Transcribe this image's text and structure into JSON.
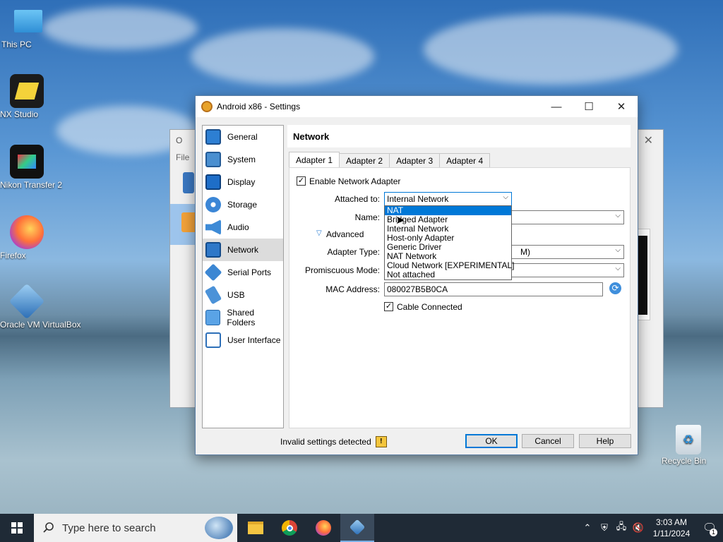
{
  "desktop": {
    "icons": [
      {
        "label": "This PC"
      },
      {
        "label": "NX Studio"
      },
      {
        "label": "Nikon Transfer 2"
      },
      {
        "label": "Firefox"
      },
      {
        "label": "Oracle VM VirtualBox"
      },
      {
        "label": "Recycle Bin"
      }
    ]
  },
  "background_window": {
    "menu_file": "File",
    "title_initial": "O"
  },
  "dialog": {
    "title": "Android x86 - Settings",
    "nav": [
      {
        "label": "General",
        "icon": "general-icon"
      },
      {
        "label": "System",
        "icon": "system-icon"
      },
      {
        "label": "Display",
        "icon": "display-icon"
      },
      {
        "label": "Storage",
        "icon": "storage-icon"
      },
      {
        "label": "Audio",
        "icon": "audio-icon"
      },
      {
        "label": "Network",
        "icon": "network-icon",
        "active": true
      },
      {
        "label": "Serial Ports",
        "icon": "serial-ports-icon"
      },
      {
        "label": "USB",
        "icon": "usb-icon"
      },
      {
        "label": "Shared Folders",
        "icon": "shared-folders-icon"
      },
      {
        "label": "User Interface",
        "icon": "user-interface-icon"
      }
    ],
    "section_title": "Network",
    "tabs": [
      "Adapter 1",
      "Adapter 2",
      "Adapter 3",
      "Adapter 4"
    ],
    "active_tab": "Adapter 1",
    "enable_adapter_label": "Enable Network Adapter",
    "enable_adapter_checked": true,
    "attached_to_label": "Attached to:",
    "attached_to_value": "Internal Network",
    "name_label": "Name:",
    "advanced_label": "Advanced",
    "adapter_type_label": "Adapter Type:",
    "adapter_type_value_partial": "M)",
    "promiscuous_label": "Promiscuous Mode:",
    "mac_label": "MAC Address:",
    "mac_value": "080027B5B0CA",
    "cable_label": "Cable Connected",
    "cable_checked": true,
    "dropdown_options": [
      "NAT",
      "Bridged Adapter",
      "Internal Network",
      "Host-only Adapter",
      "Generic Driver",
      "NAT Network",
      "Cloud Network [EXPERIMENTAL]",
      "Not attached"
    ],
    "dropdown_highlighted": "NAT",
    "status_text": "Invalid settings detected",
    "buttons": {
      "ok": "OK",
      "cancel": "Cancel",
      "help": "Help"
    }
  },
  "taskbar": {
    "search_placeholder": "Type here to search",
    "time": "3:03 AM",
    "date": "1/11/2024",
    "notification_count": "1"
  },
  "colors": {
    "accent": "#0078d7",
    "taskbar": "#1f2a36"
  }
}
